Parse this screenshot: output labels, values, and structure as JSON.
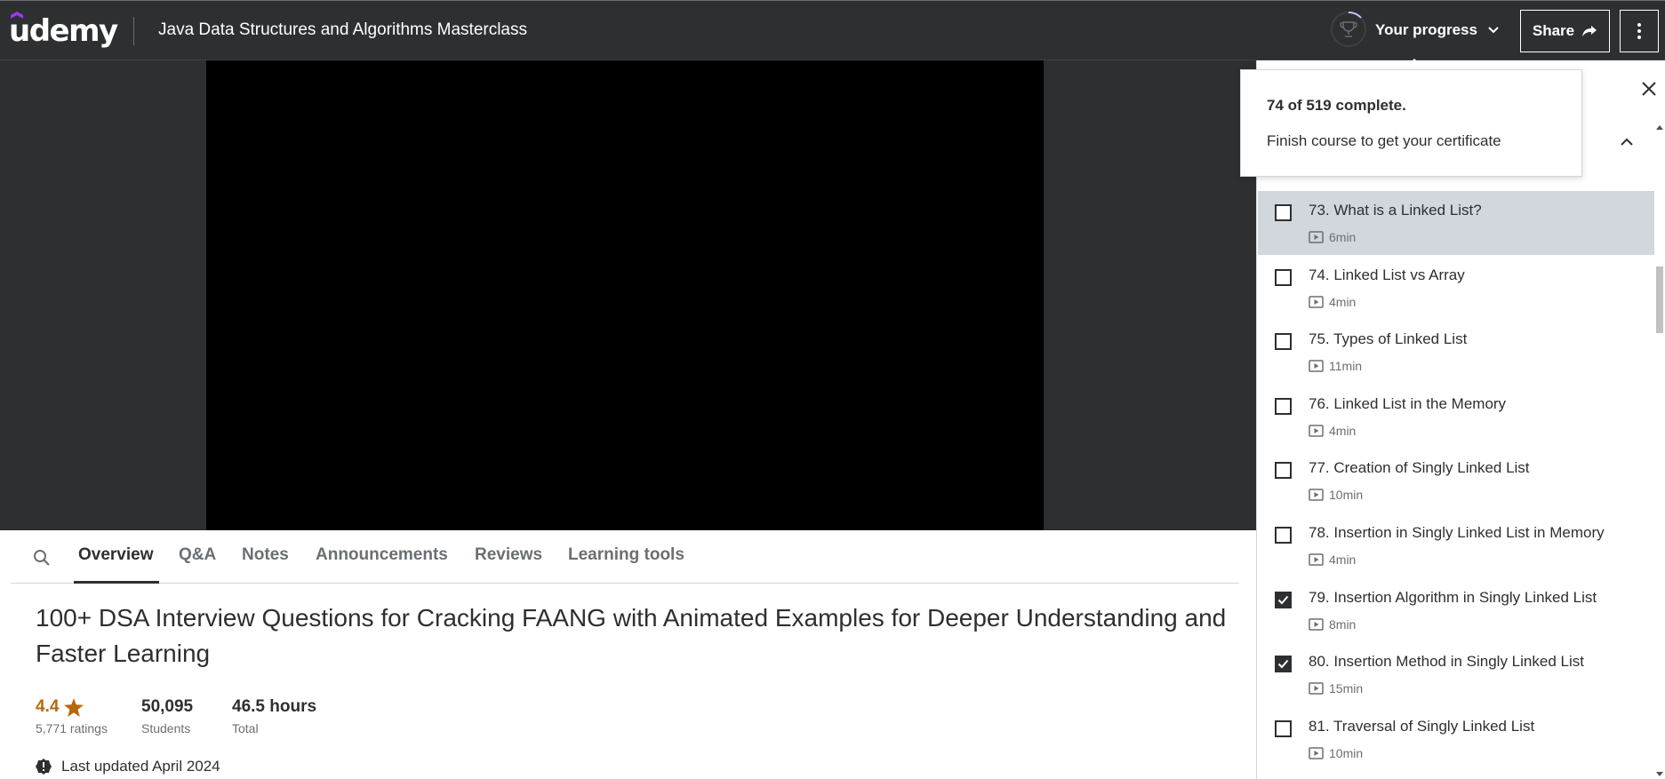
{
  "header": {
    "logo_text": "udemy",
    "course_title": "Java Data Structures and Algorithms Masterclass",
    "progress_label": "Your progress",
    "share_label": "Share"
  },
  "colors": {
    "header_bg": "#2d2f31",
    "brand_purple": "#a435f0",
    "rating_orange": "#b4690e",
    "active_lecture_bg": "#d1d7dc"
  },
  "popover": {
    "title": "74 of 519 complete.",
    "text": "Finish course to get your certificate"
  },
  "tabs": [
    {
      "label": "Overview",
      "active": true
    },
    {
      "label": "Q&A",
      "active": false
    },
    {
      "label": "Notes",
      "active": false
    },
    {
      "label": "Announcements",
      "active": false
    },
    {
      "label": "Reviews",
      "active": false
    },
    {
      "label": "Learning tools",
      "active": false
    }
  ],
  "overview": {
    "heading": "100+ DSA Interview Questions for Cracking FAANG with Animated Examples for Deeper Understanding and Faster Learning",
    "rating_value": "4.4",
    "rating_label": "5,771 ratings",
    "students_value": "50,095",
    "students_label": "Students",
    "hours_value": "46.5 hours",
    "hours_label": "Total",
    "updated": "Last updated April 2024"
  },
  "lectures": [
    {
      "title": "73. What is a Linked List?",
      "duration": "6min",
      "checked": false,
      "active": true
    },
    {
      "title": "74. Linked List vs Array",
      "duration": "4min",
      "checked": false,
      "active": false
    },
    {
      "title": "75. Types of Linked List",
      "duration": "11min",
      "checked": false,
      "active": false
    },
    {
      "title": "76. Linked List in the Memory",
      "duration": "4min",
      "checked": false,
      "active": false
    },
    {
      "title": "77. Creation of Singly Linked List",
      "duration": "10min",
      "checked": false,
      "active": false
    },
    {
      "title": "78. Insertion in Singly Linked List in Memory",
      "duration": "4min",
      "checked": false,
      "active": false
    },
    {
      "title": "79. Insertion Algorithm in Singly Linked List",
      "duration": "8min",
      "checked": true,
      "active": false
    },
    {
      "title": "80. Insertion Method in Singly Linked List",
      "duration": "15min",
      "checked": true,
      "active": false
    },
    {
      "title": "81. Traversal of Singly Linked List",
      "duration": "10min",
      "checked": false,
      "active": false
    }
  ]
}
